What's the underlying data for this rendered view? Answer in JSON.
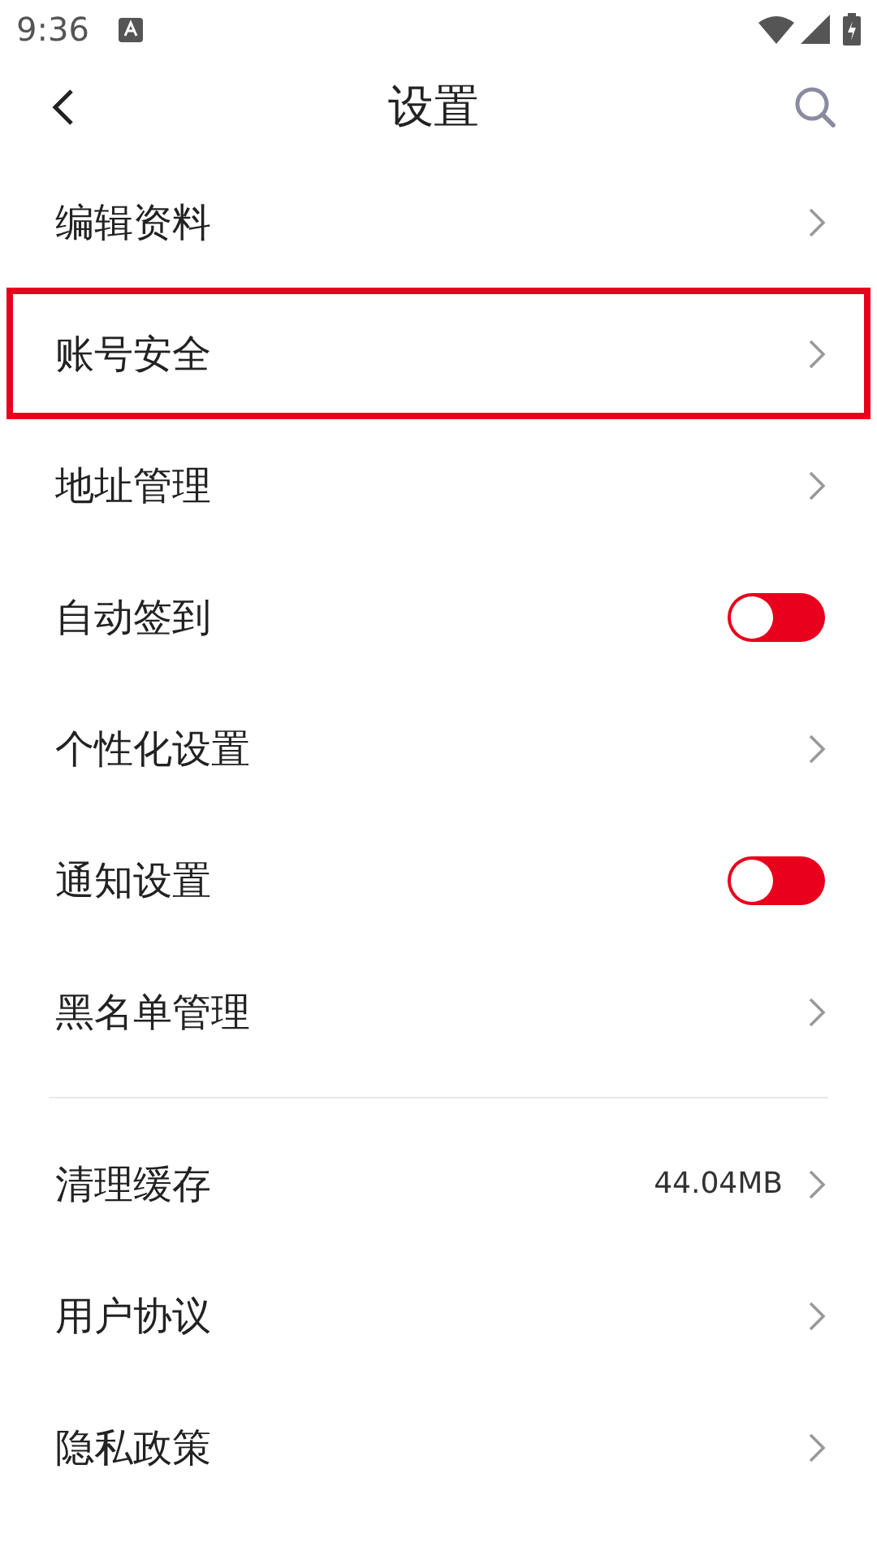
{
  "status_bar": {
    "time": "9:36"
  },
  "header": {
    "title": "设置"
  },
  "groups": [
    {
      "items": [
        {
          "kind": "link",
          "label": "编辑资料",
          "highlighted": false
        },
        {
          "kind": "link",
          "label": "账号安全",
          "highlighted": true
        },
        {
          "kind": "link",
          "label": "地址管理",
          "highlighted": false
        },
        {
          "kind": "toggle",
          "label": "自动签到",
          "on": false,
          "highlighted": false
        },
        {
          "kind": "link",
          "label": "个性化设置",
          "highlighted": false
        },
        {
          "kind": "toggle",
          "label": "通知设置",
          "on": false,
          "highlighted": false
        },
        {
          "kind": "link",
          "label": "黑名单管理",
          "highlighted": false
        }
      ]
    },
    {
      "items": [
        {
          "kind": "link",
          "label": "清理缓存",
          "value": "44.04MB",
          "highlighted": false
        },
        {
          "kind": "link",
          "label": "用户协议",
          "highlighted": false
        },
        {
          "kind": "link",
          "label": "隐私政策",
          "highlighted": false
        }
      ]
    }
  ]
}
